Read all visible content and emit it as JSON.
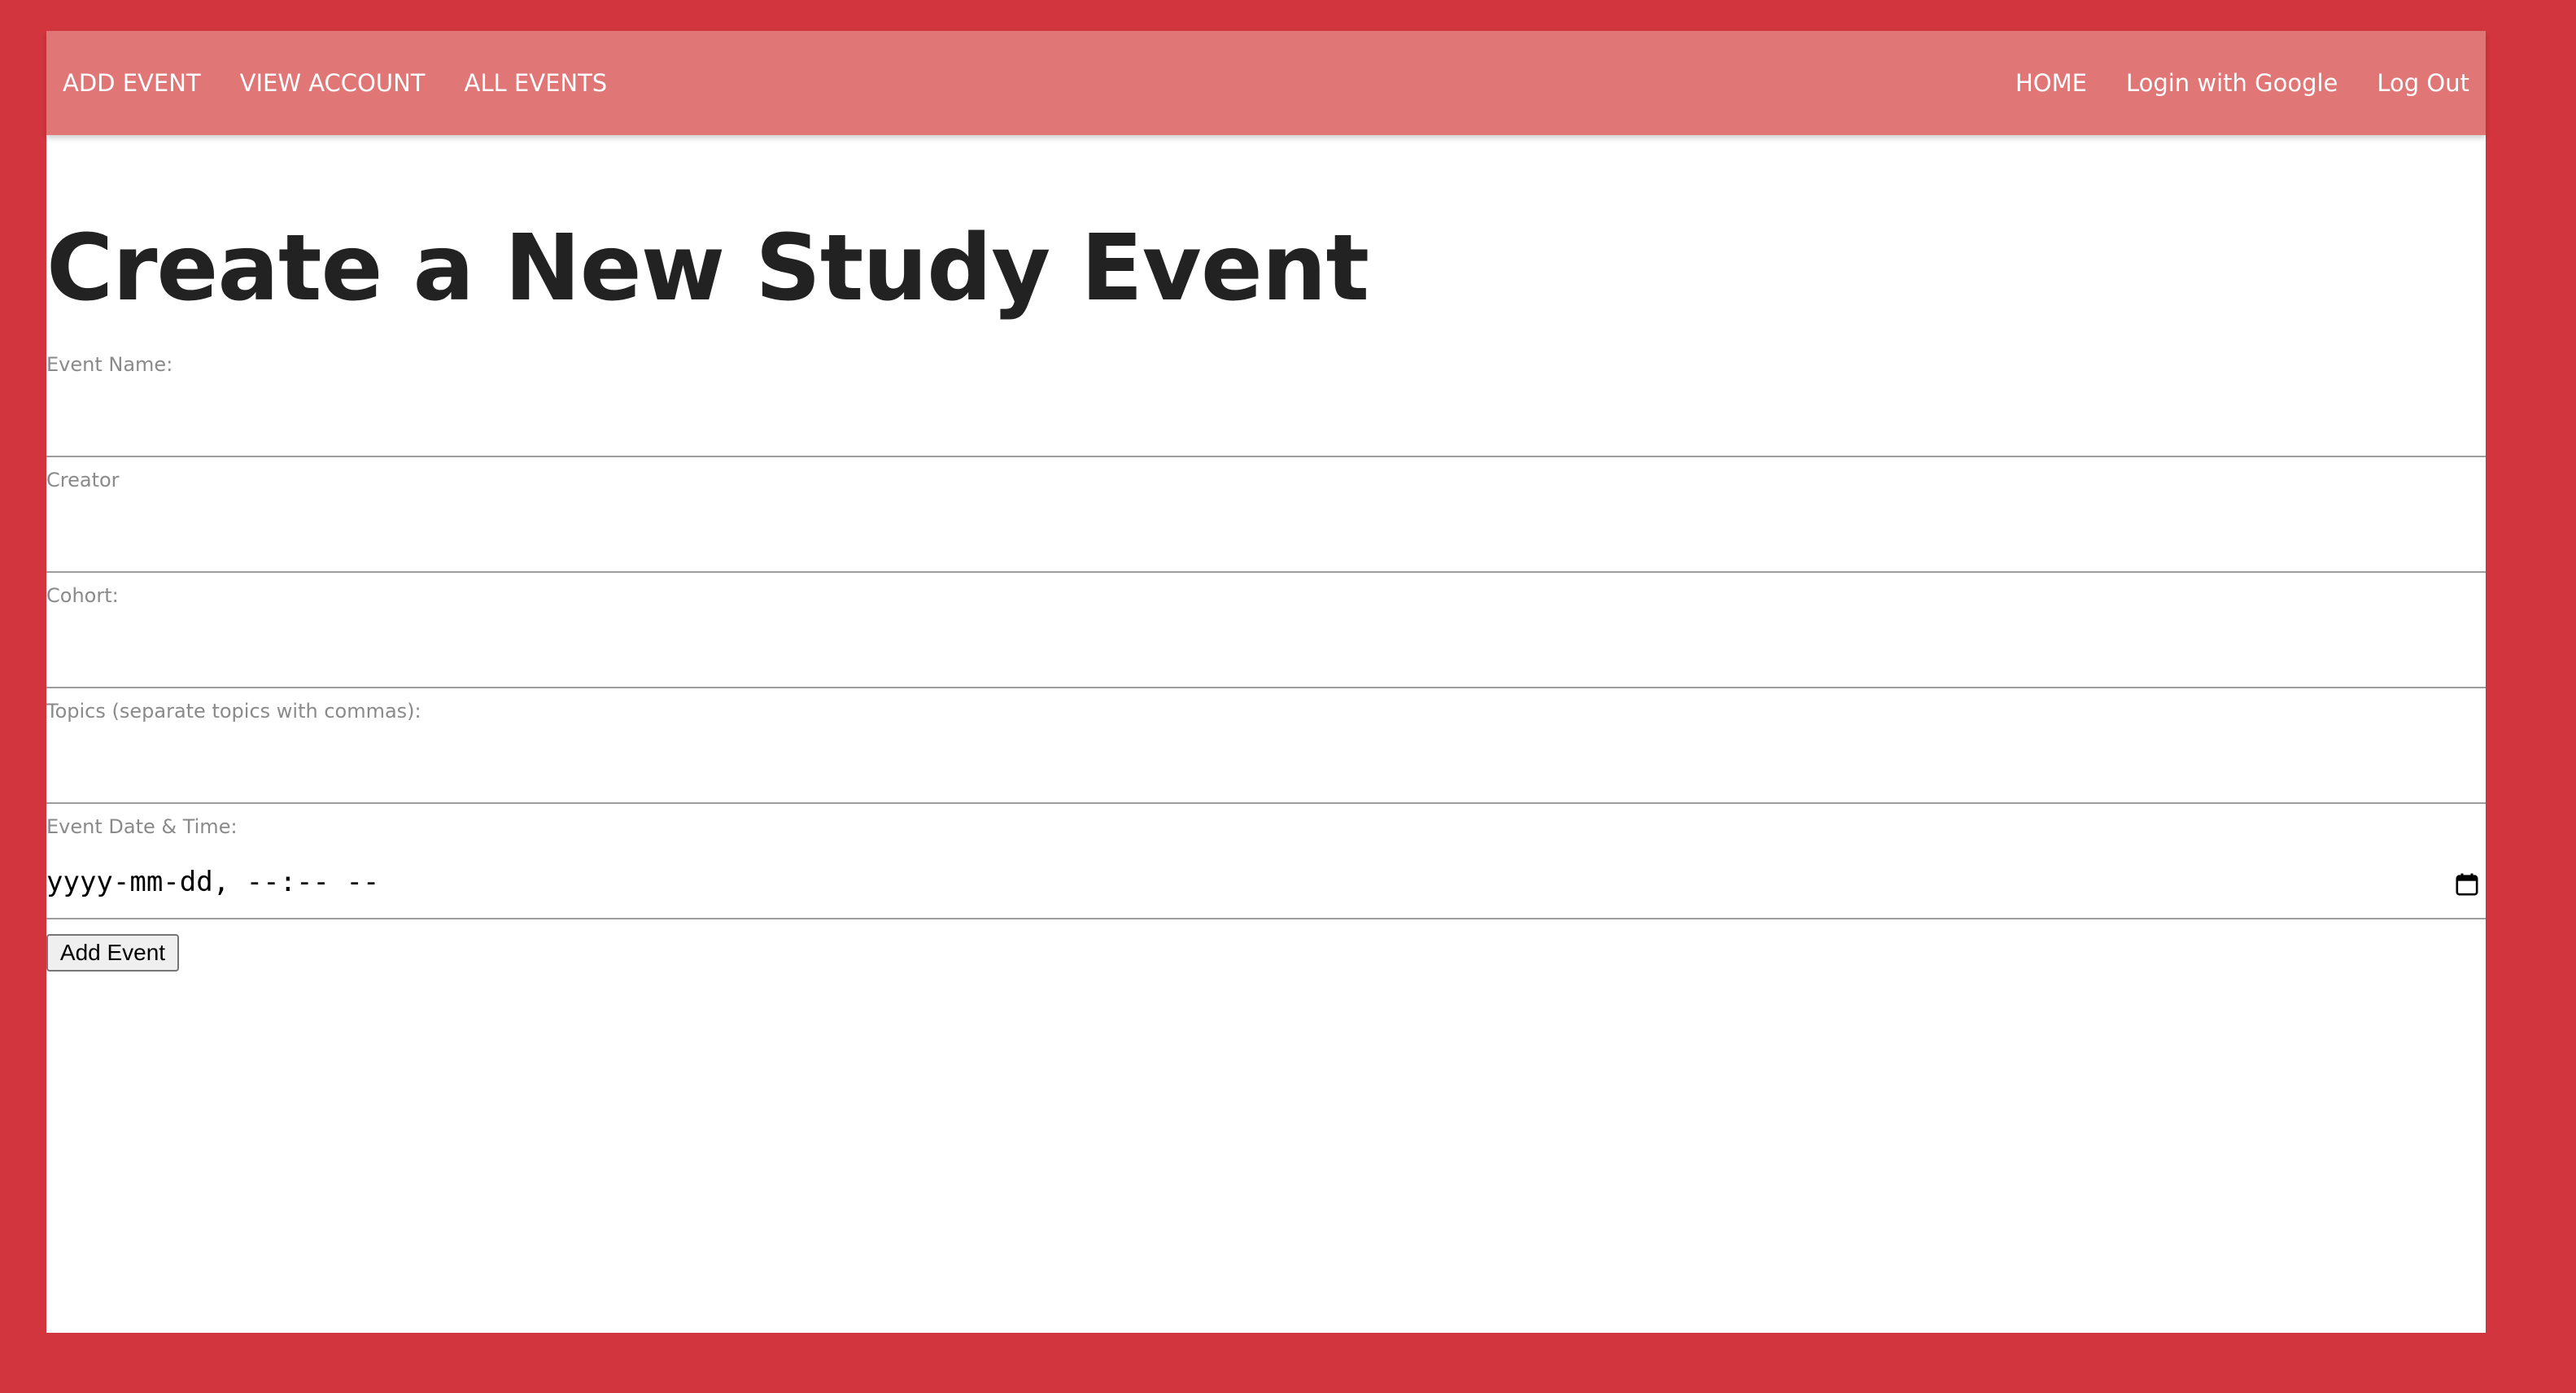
{
  "nav": {
    "left": [
      {
        "label": "ADD EVENT"
      },
      {
        "label": "VIEW ACCOUNT"
      },
      {
        "label": "ALL EVENTS"
      }
    ],
    "right": [
      {
        "label": "HOME"
      },
      {
        "label": "Login with Google"
      },
      {
        "label": "Log Out"
      }
    ]
  },
  "page": {
    "title": "Create a New Study Event"
  },
  "form": {
    "event_name": {
      "label": "Event Name:",
      "value": ""
    },
    "creator": {
      "label": "Creator",
      "value": ""
    },
    "cohort": {
      "label": "Cohort:",
      "value": ""
    },
    "topics": {
      "label": "Topics (separate topics with commas):",
      "value": ""
    },
    "event_datetime": {
      "label": "Event Date & Time:",
      "placeholder": "yyyy-mm-dd, --:-- --"
    },
    "submit_label": "Add Event"
  },
  "icons": {
    "datetime_picker": "calendar-icon"
  },
  "colors": {
    "page_background": "#d2353d",
    "navbar": "#e07676",
    "nav_text": "#ffffff",
    "title_text": "#222222",
    "label_text": "#8a8a8a"
  }
}
